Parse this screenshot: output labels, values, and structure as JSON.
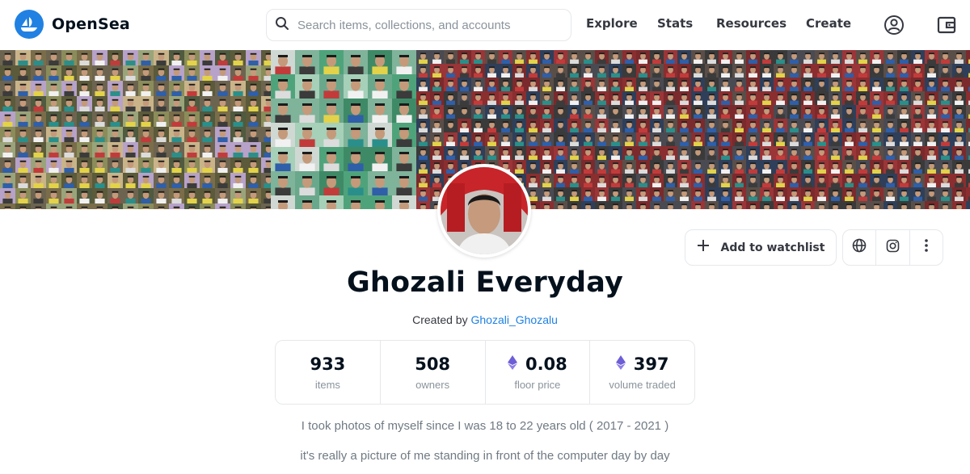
{
  "header": {
    "brand": "OpenSea",
    "search_placeholder": "Search items, collections, and accounts",
    "nav": [
      "Explore",
      "Stats",
      "Resources",
      "Create"
    ],
    "icons": [
      "profile-icon",
      "wallet-icon"
    ],
    "brand_color": "#2081e2"
  },
  "collection": {
    "name": "Ghozali Everyday",
    "created_by_prefix": "Created by",
    "creator": "Ghozali_Ghozalu",
    "watchlist_label": "Add to watchlist",
    "social_icons": [
      "globe-icon",
      "instagram-icon",
      "more-icon"
    ]
  },
  "stats": [
    {
      "value": "933",
      "label": "items",
      "eth": false
    },
    {
      "value": "508",
      "label": "owners",
      "eth": false
    },
    {
      "value": "0.08",
      "label": "floor price",
      "eth": true
    },
    {
      "value": "397",
      "label": "volume traded",
      "eth": true
    }
  ],
  "description": [
    "I took photos of myself since I was 18 to 22 years old ( 2017 - 2021 )",
    "it's really a picture of me standing in front of the computer day by day"
  ],
  "colors": {
    "text": "#04111d",
    "muted": "#8a939b",
    "border": "#e5e8eb",
    "link": "#2081e2",
    "eth": "#6d5ed6"
  }
}
